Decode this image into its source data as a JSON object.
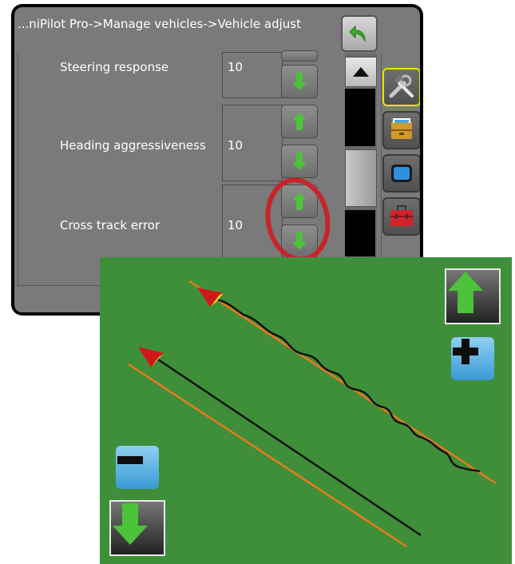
{
  "breadcrumb": "...niPilot Pro->Manage vehicles->Vehicle adjust",
  "settings": [
    {
      "label": "Steering response",
      "value": "10"
    },
    {
      "label": "Heading aggressiveness",
      "value": "10"
    },
    {
      "label": "Cross track error",
      "value": "10"
    }
  ],
  "highlight_color": "#c8242b",
  "field_color": "#3f8f3a",
  "guide_line_color": "#e87a1a",
  "icons": {
    "back": "back-arrow-icon",
    "up": "green-up-arrow-icon",
    "down": "green-down-arrow-icon",
    "tools": "tools-icon",
    "config": "drawer-icon",
    "display": "monitor-icon",
    "toolbox": "toolbox-icon",
    "plus": "plus-icon",
    "minus": "minus-icon"
  }
}
